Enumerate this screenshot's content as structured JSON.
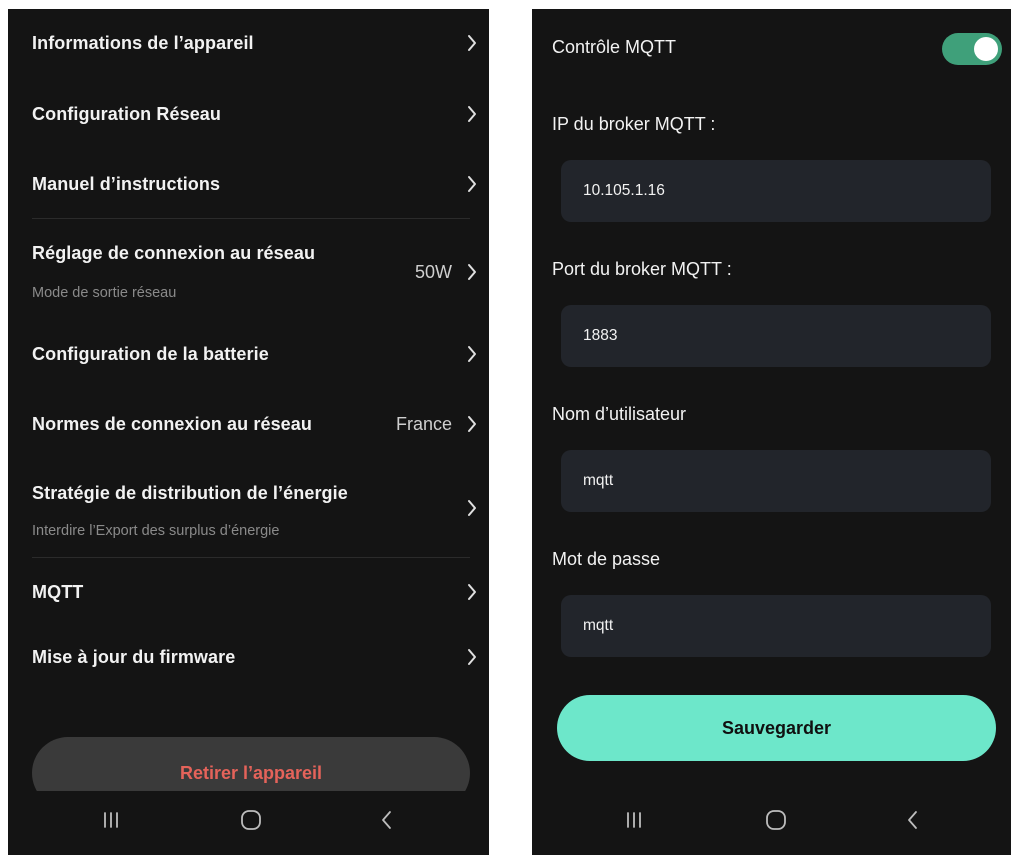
{
  "colors": {
    "background": "#141414",
    "text_primary": "#f2f2f2",
    "text_secondary": "#8a8a8a",
    "danger": "#e5635a",
    "accent": "#6de7ca",
    "toggle_on": "#3fa07a",
    "field_bg": "#22252b"
  },
  "device_settings": {
    "items": [
      {
        "title": "Informations de l’appareil",
        "subtitle": "",
        "value": ""
      },
      {
        "title": "Configuration Réseau",
        "subtitle": "",
        "value": ""
      },
      {
        "title": "Manuel d’instructions",
        "subtitle": "",
        "value": ""
      },
      {
        "title": "Réglage de connexion au réseau",
        "subtitle": "Mode de sortie réseau",
        "value": "50W"
      },
      {
        "title": "Configuration de la batterie",
        "subtitle": "",
        "value": ""
      },
      {
        "title": "Normes de connexion au réseau",
        "subtitle": "",
        "value": "France"
      },
      {
        "title": "Stratégie de distribution de l’énergie",
        "subtitle": "Interdire l’Export des surplus d’énergie",
        "value": ""
      },
      {
        "title": "MQTT",
        "subtitle": "",
        "value": ""
      },
      {
        "title": "Mise à jour du firmware",
        "subtitle": "",
        "value": ""
      }
    ],
    "remove_button_label": "Retirer l’appareil",
    "chevron_icon": "chevron-right-icon"
  },
  "mqtt": {
    "control_label": "Contrôle MQTT",
    "control_enabled": true,
    "broker_ip_label": "IP du broker MQTT :",
    "broker_ip_value": "10.105.1.16",
    "broker_port_label": "Port du broker MQTT :",
    "broker_port_value": "1883",
    "username_label": "Nom d’utilisateur",
    "username_value": "mqtt",
    "password_label": "Mot de passe",
    "password_value": "mqtt",
    "save_button_label": "Sauvegarder"
  },
  "navbar": {
    "icons": [
      "recent-apps-icon",
      "home-icon",
      "back-icon"
    ]
  }
}
